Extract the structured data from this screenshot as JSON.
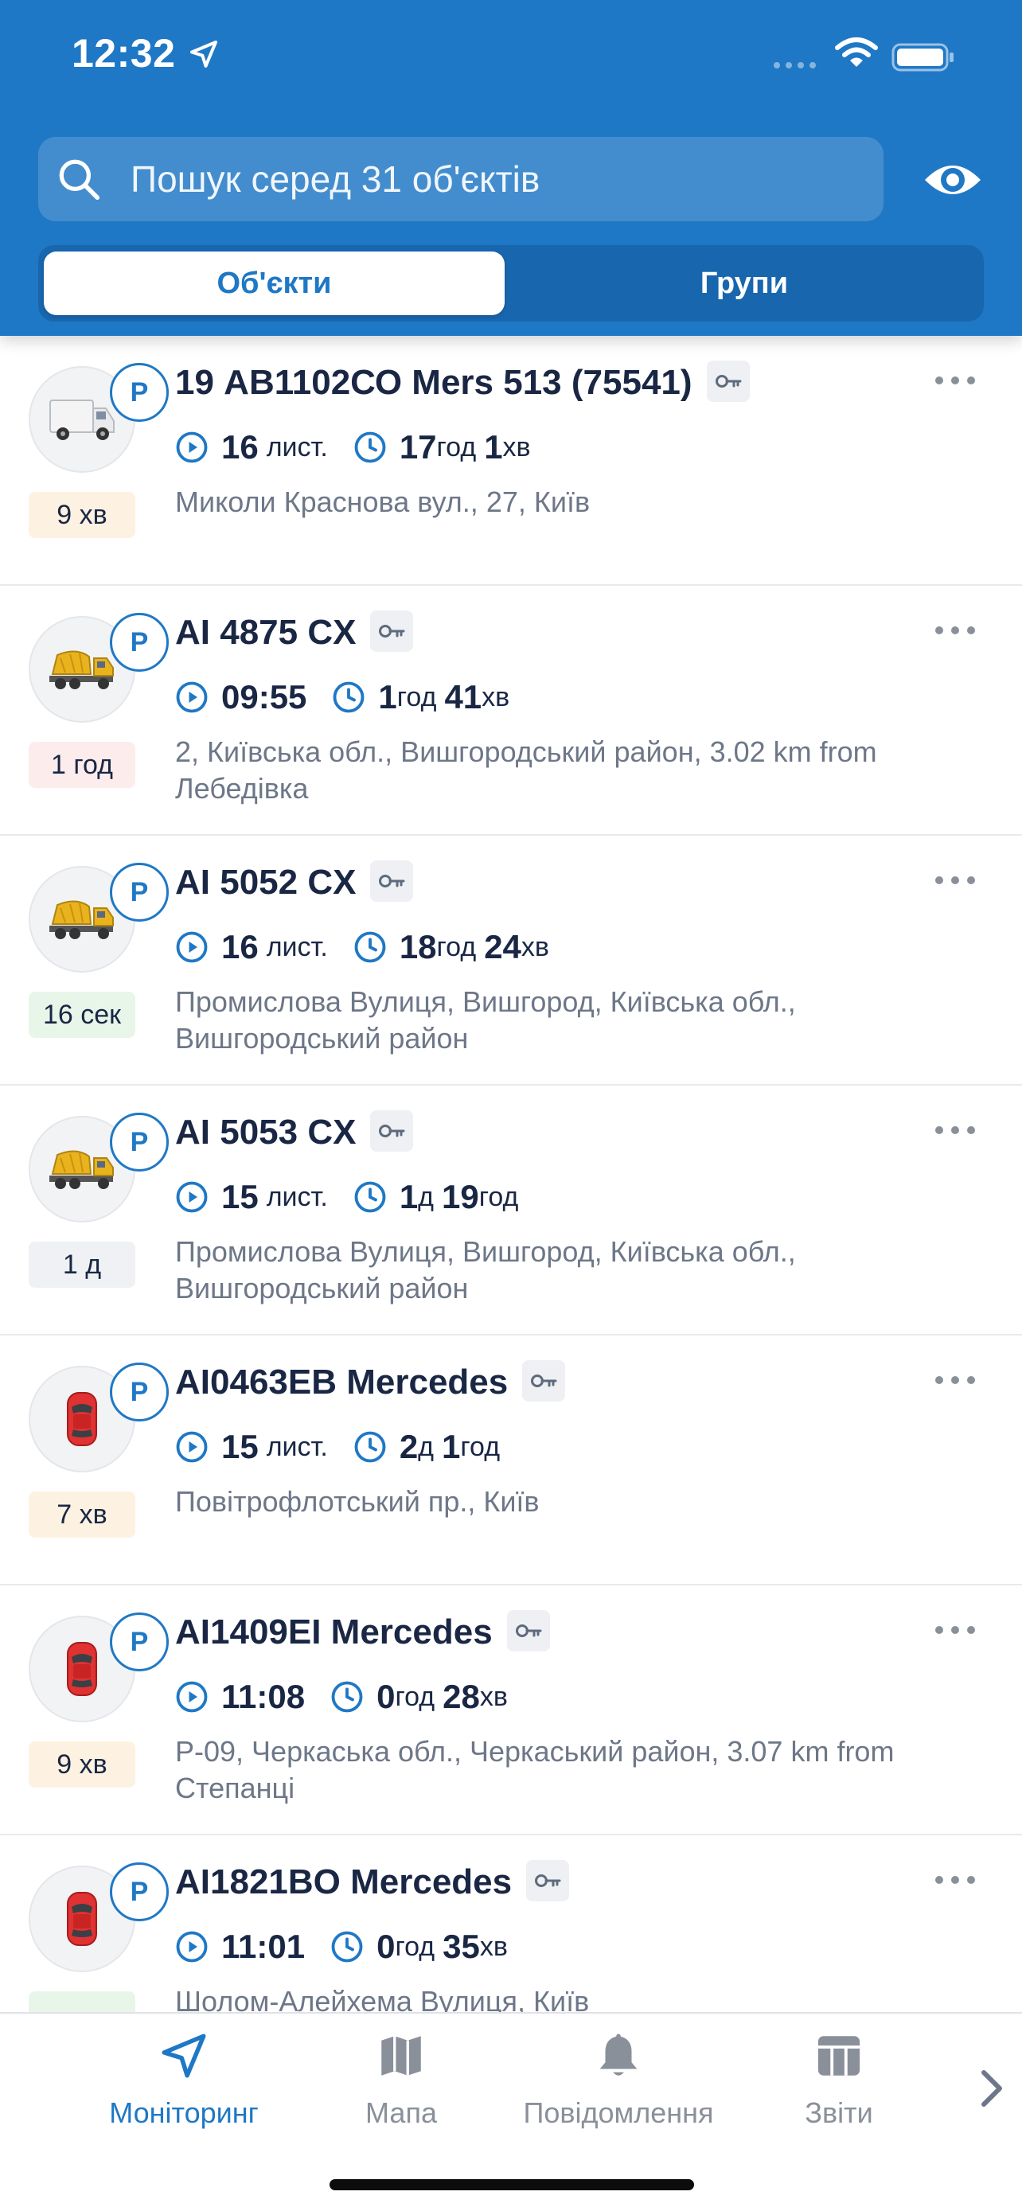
{
  "status_bar": {
    "time": "12:32"
  },
  "search": {
    "placeholder": "Пошук серед 31 об'єктів"
  },
  "segments": {
    "objects": "Об'єкти",
    "groups": "Групи"
  },
  "parking_letter": "P",
  "colors": {
    "primary": "#1f78c5",
    "text": "#1a2744",
    "muted": "#6d7788"
  },
  "items": [
    {
      "title": "19 АВ1102СО Mers 513 (75541)",
      "vehicle_icon": "van-icon",
      "time_label": "16",
      "time_unit": "лист.",
      "dur_v1": "17",
      "dur_u1": "год",
      "dur_v2": "1",
      "dur_u2": "хв",
      "badge": "9 хв",
      "badge_color": "orange",
      "address": "Миколи Краснова вул., 27, Київ"
    },
    {
      "title": "AI 4875 CX",
      "vehicle_icon": "concrete-mixer-icon",
      "time_label": "09:55",
      "time_unit": "",
      "dur_v1": "1",
      "dur_u1": "год",
      "dur_v2": "41",
      "dur_u2": "хв",
      "badge": "1 год",
      "badge_color": "red",
      "address": "2, Київська обл., Вишгородський район, 3.02 km from Лебедівка"
    },
    {
      "title": "AI 5052 CX",
      "vehicle_icon": "concrete-mixer-icon",
      "time_label": "16",
      "time_unit": "лист.",
      "dur_v1": "18",
      "dur_u1": "год",
      "dur_v2": "24",
      "dur_u2": "хв",
      "badge": "16 сек",
      "badge_color": "green",
      "address": "Промислова Вулиця, Вишгород, Київська обл., Вишгородський район"
    },
    {
      "title": "AI 5053 CX",
      "vehicle_icon": "concrete-mixer-icon",
      "time_label": "15",
      "time_unit": "лист.",
      "dur_v1": "1",
      "dur_u1": "д",
      "dur_v2": "19",
      "dur_u2": "год",
      "badge": "1 д",
      "badge_color": "gray",
      "address": "Промислова Вулиця, Вишгород, Київська обл., Вишгородський район"
    },
    {
      "title": "AI0463EB Mercedes",
      "vehicle_icon": "red-car-icon",
      "time_label": "15",
      "time_unit": "лист.",
      "dur_v1": "2",
      "dur_u1": "д",
      "dur_v2": "1",
      "dur_u2": "год",
      "badge": "7 хв",
      "badge_color": "orange",
      "address": "Повітрофлотський пр., Київ"
    },
    {
      "title": "AI1409EI Mercedes",
      "vehicle_icon": "red-car-icon",
      "time_label": "11:08",
      "time_unit": "",
      "dur_v1": "0",
      "dur_u1": "год",
      "dur_v2": "28",
      "dur_u2": "хв",
      "badge": "9 хв",
      "badge_color": "orange",
      "address": "Р-09, Черкаська обл., Черкаський район, 3.07 km from Степанці"
    },
    {
      "title": "AI1821BO Mercedes",
      "vehicle_icon": "red-car-icon",
      "time_label": "11:01",
      "time_unit": "",
      "dur_v1": "0",
      "dur_u1": "год",
      "dur_v2": "35",
      "dur_u2": "хв",
      "badge": "",
      "badge_color": "green",
      "address": "Шолом-Алейхема Вулиця, Київ"
    }
  ],
  "tabbar": {
    "monitoring": "Моніторинг",
    "map": "Мапа",
    "notifications": "Повідомлення",
    "reports": "Звіти"
  }
}
